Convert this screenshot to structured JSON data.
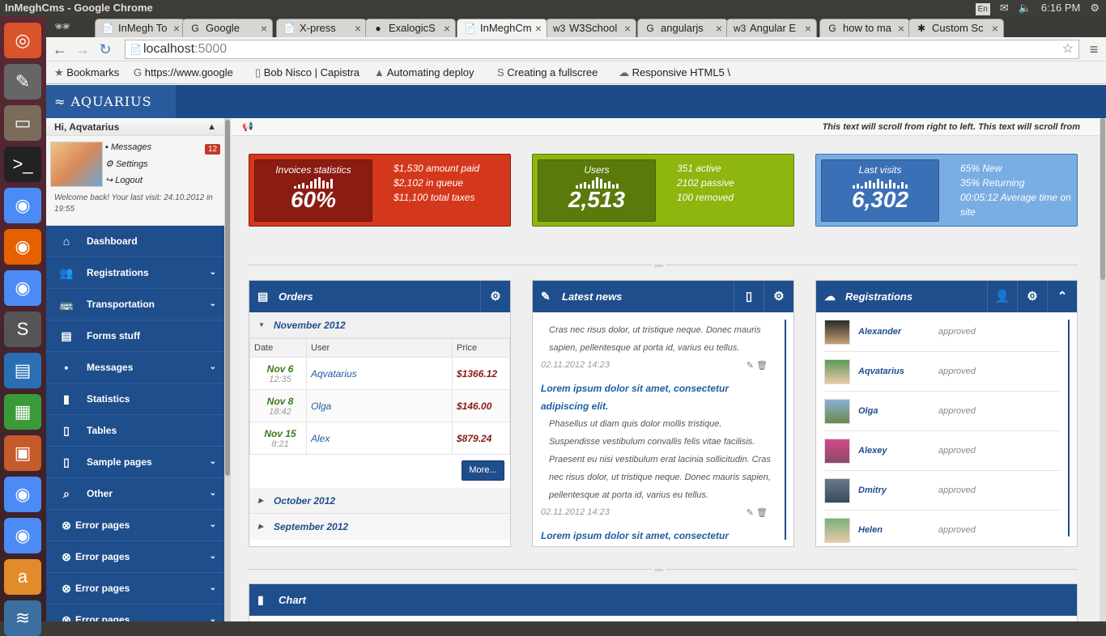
{
  "os": {
    "window_title": "InMeghCms - Google Chrome",
    "lang": "En",
    "time": "6:16 PM"
  },
  "launcher": [
    "ubuntu-icon",
    "text-editor-icon",
    "file-manager-icon",
    "terminal-icon",
    "chrome-icon",
    "firefox-icon",
    "chromium-icon",
    "sublime-icon",
    "writer-icon",
    "calc-icon",
    "impress-icon",
    "chrome-icon",
    "chrome-icon",
    "amazon-icon",
    "stack-icon"
  ],
  "tabs": [
    {
      "label": "InMegh To",
      "fav": "📄"
    },
    {
      "label": "Google",
      "fav": "G"
    },
    {
      "label": "X-press",
      "fav": "📄"
    },
    {
      "label": "ExalogicS",
      "fav": "●"
    },
    {
      "label": "InMeghCm",
      "fav": "📄",
      "active": true
    },
    {
      "label": "W3School",
      "fav": "w3"
    },
    {
      "label": "angularjs",
      "fav": "G"
    },
    {
      "label": "Angular E",
      "fav": "w3"
    },
    {
      "label": "how to ma",
      "fav": "G"
    },
    {
      "label": "Custom Sc",
      "fav": "✱"
    }
  ],
  "address": {
    "host": "localhost",
    "port": ":5000"
  },
  "bookmarks": [
    "Bookmarks",
    "https://www.google",
    "Bob Nisco | Capistra",
    "Automating deploy",
    "Creating a fullscree",
    "Responsive HTML5 \\"
  ],
  "app": {
    "logo": "AQUARIUS"
  },
  "user": {
    "greeting": "Hi, Aqvatarius",
    "messages": "Messages",
    "settings": "Settings",
    "logout": "Logout",
    "badge": "12",
    "welcome": "Welcome back! Your last visit: 24.10.2012 in 19:55"
  },
  "nav": [
    {
      "label": "Dashboard",
      "icon": "home-icon",
      "chev": false
    },
    {
      "label": "Registrations",
      "icon": "users-icon",
      "chev": true
    },
    {
      "label": "Transportation",
      "icon": "bus-icon",
      "chev": true
    },
    {
      "label": "Forms stuff",
      "icon": "inbox-icon",
      "chev": false
    },
    {
      "label": "Messages",
      "icon": "comment-icon",
      "chev": true
    },
    {
      "label": "Statistics",
      "icon": "bar-chart-icon",
      "chev": false
    },
    {
      "label": "Tables",
      "icon": "file-icon",
      "chev": false
    },
    {
      "label": "Sample pages",
      "icon": "pages-icon",
      "chev": true
    },
    {
      "label": "Other",
      "icon": "search-icon",
      "chev": true
    },
    {
      "label": "Error pages",
      "icon": "error-icon",
      "chev": true
    },
    {
      "label": "Error pages",
      "icon": "error-icon",
      "chev": true
    },
    {
      "label": "Error pages",
      "icon": "error-icon",
      "chev": true
    },
    {
      "label": "Error pages",
      "icon": "error-icon",
      "chev": true
    }
  ],
  "ticker": "This text will scroll from right to left. This text will scroll from",
  "stats": [
    {
      "title": "Invoices statistics",
      "value": "60%",
      "lines": [
        "$1,530 amount paid",
        "$2,102 in queue",
        "$11,100 total taxes"
      ],
      "bg": "#d4381c",
      "inner": "#8a1c12"
    },
    {
      "title": "Users",
      "value": "2,513",
      "lines": [
        "351 active",
        "2102 passive",
        "100 removed"
      ],
      "bg": "#8fb50f",
      "inner": "#5b7a0c"
    },
    {
      "title": "Last visits",
      "value": "6,302",
      "lines": [
        "65% New",
        "35% Returning",
        "00:05:12 Average time on site"
      ],
      "bg": "#7aaee3",
      "inner": "#3a70b5"
    }
  ],
  "orders": {
    "title": "Orders",
    "group_open": "November 2012",
    "headers": [
      "Date",
      "User",
      "Price"
    ],
    "rows": [
      {
        "date": "Nov 6",
        "time": "12:35",
        "user": "Aqvatarius",
        "price": "$1366.12"
      },
      {
        "date": "Nov 8",
        "time": "18:42",
        "user": "Olga",
        "price": "$146.00"
      },
      {
        "date": "Nov 15",
        "time": "8:21",
        "user": "Alex",
        "price": "$879.24"
      }
    ],
    "more": "More...",
    "groups_closed": [
      "October 2012",
      "September 2012"
    ]
  },
  "news": {
    "title": "Latest news",
    "items": [
      {
        "body": "Cras nec risus dolor, ut tristique neque. Donec mauris sapien, pellentesque at porta id, varius eu tellus.",
        "date": "02.11.2012 14:23"
      },
      {
        "heading": "Lorem ipsum dolor sit amet, consectetur adipiscing elit.",
        "body": "Phasellus ut diam quis dolor mollis tristique. Suspendisse vestibulum convallis felis vitae facilisis. Praesent eu nisi vestibulum erat lacinia sollicitudin. Cras nec risus dolor, ut tristique neque. Donec mauris sapien, pellentesque at porta id, varius eu tellus.",
        "date": "02.11.2012 14:23"
      },
      {
        "heading": "Lorem ipsum dolor sit amet, consectetur"
      }
    ]
  },
  "registrations": {
    "title": "Registrations",
    "items": [
      {
        "name": "Alexander",
        "status": "approved"
      },
      {
        "name": "Aqvatarius",
        "status": "approved"
      },
      {
        "name": "Olga",
        "status": "approved"
      },
      {
        "name": "Alexey",
        "status": "approved"
      },
      {
        "name": "Dmitry",
        "status": "approved"
      },
      {
        "name": "Helen",
        "status": "approved"
      }
    ]
  },
  "chart": {
    "title": "Chart"
  }
}
